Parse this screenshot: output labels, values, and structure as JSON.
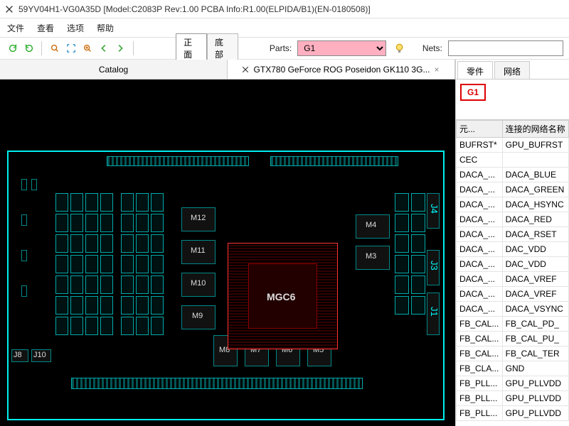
{
  "title": "59YV04H1-VG0A35D  [Model:C2083P Rev:1.00 PCBA Info:R1.00(ELPIDA/B1)(EN-0180508)]",
  "menu": {
    "file": "文件",
    "view": "查看",
    "options": "选项",
    "help": "帮助"
  },
  "toolbar": {
    "side_front": "正面",
    "side_back": "底部",
    "parts_label": "Parts:",
    "parts_value": "G1",
    "nets_label": "Nets:",
    "nets_value": ""
  },
  "tabs": {
    "catalog": "Catalog",
    "board": "GTX780 GeForce ROG Poseidon GK110 3G..."
  },
  "pcb": {
    "center_label": "MGC6",
    "mem": [
      "M12",
      "M11",
      "M10",
      "M9",
      "M8",
      "M7",
      "M6",
      "M5",
      "M4",
      "M3"
    ],
    "j_left": [
      "J8",
      "J10"
    ],
    "j_right": [
      "J4",
      "J3",
      "J1"
    ]
  },
  "side": {
    "tab_parts": "零件",
    "tab_nets": "网络",
    "selected": "G1",
    "col1": "元...",
    "col2": "连接的网络名称",
    "rows": [
      {
        "a": "BUFRST*",
        "b": "GPU_BUFRST"
      },
      {
        "a": "CEC",
        "b": ""
      },
      {
        "a": "DACA_...",
        "b": "DACA_BLUE"
      },
      {
        "a": "DACA_...",
        "b": "DACA_GREEN"
      },
      {
        "a": "DACA_...",
        "b": "DACA_HSYNC"
      },
      {
        "a": "DACA_...",
        "b": "DACA_RED"
      },
      {
        "a": "DACA_...",
        "b": "DACA_RSET"
      },
      {
        "a": "DACA_...",
        "b": "DAC_VDD"
      },
      {
        "a": "DACA_...",
        "b": "DAC_VDD"
      },
      {
        "a": "DACA_...",
        "b": "DACA_VREF"
      },
      {
        "a": "DACA_...",
        "b": "DACA_VREF"
      },
      {
        "a": "DACA_...",
        "b": "DACA_VSYNC"
      },
      {
        "a": "FB_CAL...",
        "b": "FB_CAL_PD_"
      },
      {
        "a": "FB_CAL...",
        "b": "FB_CAL_PU_"
      },
      {
        "a": "FB_CAL...",
        "b": "FB_CAL_TER"
      },
      {
        "a": "FB_CLA...",
        "b": "GND"
      },
      {
        "a": "FB_PLL...",
        "b": "GPU_PLLVDD"
      },
      {
        "a": "FB_PLL...",
        "b": "GPU_PLLVDD"
      },
      {
        "a": "FB_PLL...",
        "b": "GPU_PLLVDD"
      }
    ]
  }
}
